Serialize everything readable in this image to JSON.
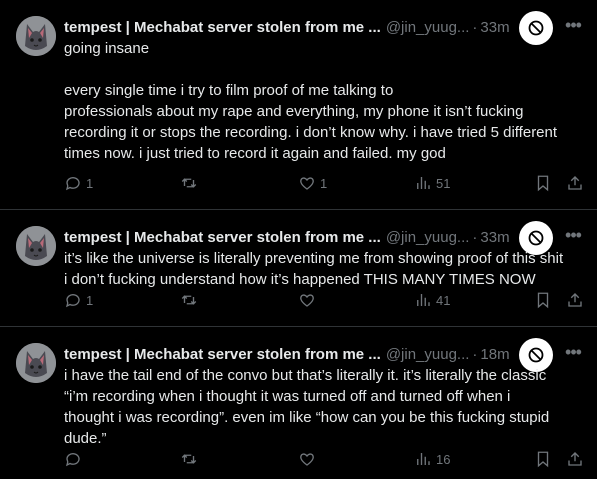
{
  "tweets": [
    {
      "name": "tempest | Mechabat server stolen from me ...",
      "handle": "@jin_yuug...",
      "time": "33m",
      "text": "going insane\n\nevery single time i try to film proof of me talking to\nprofessionals about my rape and everything, my phone it isn’t fucking\nrecording it or stops the recording. i don’t know why. i have tried 5 different\ntimes now. i just tried to record it again and failed. my god",
      "replies": "1",
      "retweets": "",
      "likes": "1",
      "views": "51"
    },
    {
      "name": "tempest | Mechabat server stolen from me ...",
      "handle": "@jin_yuug...",
      "time": "33m",
      "text": "it’s like the universe is literally preventing me from showing proof of this shit\ni don’t fucking understand how it’s happened THIS MANY TIMES NOW",
      "replies": "1",
      "retweets": "",
      "likes": "",
      "views": "41"
    },
    {
      "name": "tempest | Mechabat server stolen from me ...",
      "handle": "@jin_yuug...",
      "time": "18m",
      "text": "i have the tail end of the convo but that’s literally it. it’s literally the classic\n“i’m recording when i thought it was turned off and turned off when i\nthought i was recording”. even im like “how can you be this fucking stupid\ndude.”",
      "replies": "",
      "retweets": "",
      "likes": "",
      "views": "16"
    }
  ],
  "colors": {
    "background": "#000000",
    "text": "#e7e9ea",
    "muted": "#71767b",
    "divider": "#2f3336"
  }
}
